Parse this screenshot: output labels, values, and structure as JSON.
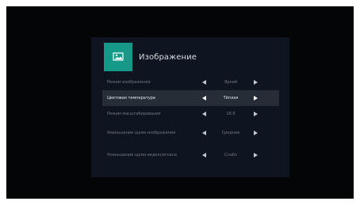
{
  "menu": {
    "title": "Изображение",
    "icon": "picture-icon",
    "accent_color": "#159a8a",
    "items": [
      {
        "label": "Режим изображения",
        "value": "Яркий"
      },
      {
        "label": "Цветовая температура",
        "value": "Тёплая",
        "selected": true
      },
      {
        "label": "Режим масштабирования",
        "value": "16:9"
      },
      {
        "label": "Уменьшение шума изображения",
        "value": "Среднее"
      },
      {
        "label": "Уменьшение шума видеосигнала",
        "value": "Слабо"
      }
    ]
  }
}
